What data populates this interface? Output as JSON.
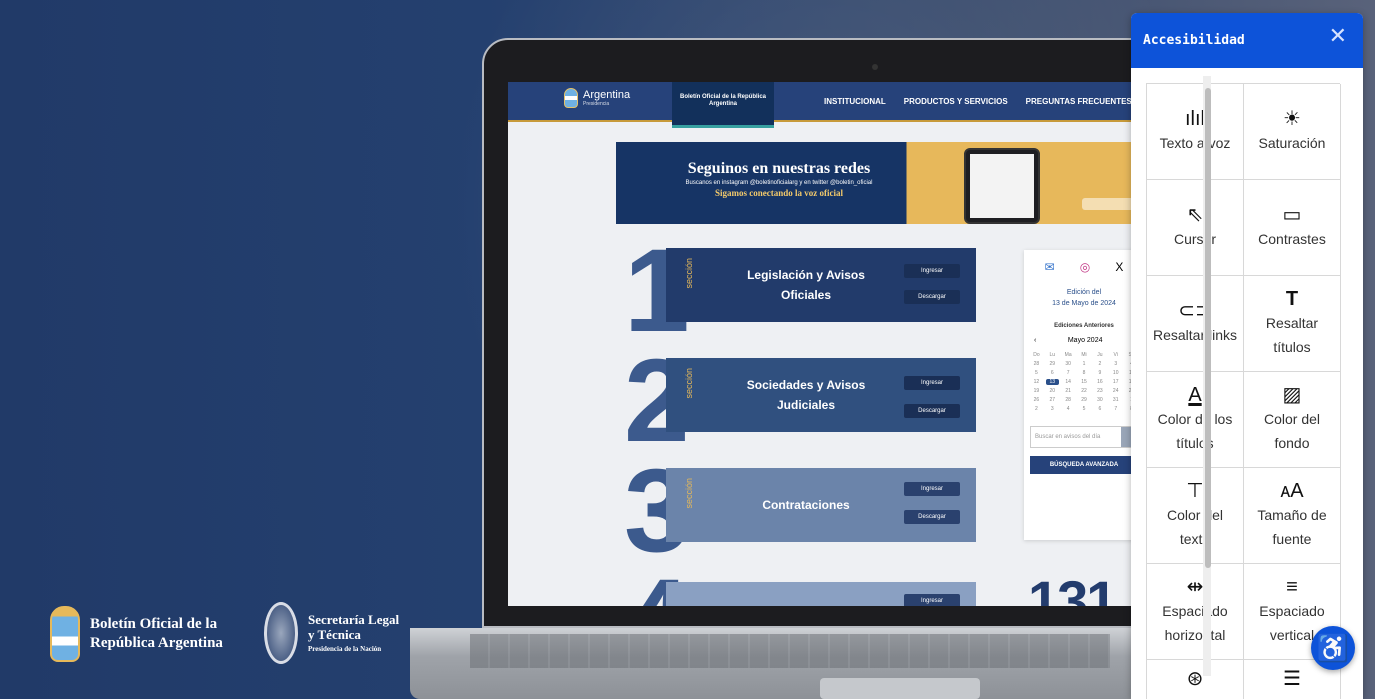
{
  "site": {
    "brand_logo": "Argentina",
    "brand_logo_sub": "Presidencia",
    "brand_title": "Boletín Oficial de la República Argentina",
    "nav": [
      "INSTITUCIONAL",
      "PRODUCTOS Y SERVICIOS",
      "PREGUNTAS FRECUENTES"
    ],
    "banner": {
      "title": "Seguinos en nuestras redes",
      "subtitle": "Buscanos en instagram @boletinoficialarg y en twitter @boletin_oficial",
      "tagline": "Sigamos conectando la voz oficial"
    },
    "sections": [
      {
        "number": "1",
        "label": "sección",
        "title": "Legislación y Avisos Oficiales",
        "btn1": "Ingresar",
        "btn2": "Descargar"
      },
      {
        "number": "2",
        "label": "sección",
        "title": "Sociedades y Avisos Judiciales",
        "btn1": "Ingresar",
        "btn2": "Descargar"
      },
      {
        "number": "3",
        "label": "sección",
        "title": "Contrataciones",
        "btn1": "Ingresar",
        "btn2": "Descargar"
      },
      {
        "number": "4",
        "label": "sección",
        "title": "",
        "btn1": "Ingresar",
        "btn2": ""
      }
    ],
    "sidebar": {
      "edition": "Edición del",
      "edition_date": "13 de Mayo de 2024",
      "previous": "Ediciones Anteriores",
      "month": "Mayo 2024",
      "search_placeholder": "Buscar en avisos del día",
      "advanced_search": "BÚSQUEDA AVANZADA",
      "big_number": "131"
    }
  },
  "accessibility": {
    "title": "Accesibilidad",
    "items": [
      {
        "label": "Texto a voz",
        "icon": "sound-wave-icon"
      },
      {
        "label": "Saturación",
        "icon": "brightness-icon"
      },
      {
        "label": "Cursor",
        "icon": "cursor-icon"
      },
      {
        "label": "Contrastes",
        "icon": "monitor-icon"
      },
      {
        "label": "Resaltar links",
        "icon": "link-icon"
      },
      {
        "label": "Resaltar títulos",
        "icon": "heading-icon"
      },
      {
        "label": "Color de los títulos",
        "icon": "text-color-icon"
      },
      {
        "label": "Color del fondo",
        "icon": "image-icon"
      },
      {
        "label": "Color del texto",
        "icon": "text-box-icon"
      },
      {
        "label": "Tamaño de fuente",
        "icon": "font-size-icon"
      },
      {
        "label": "Espaciado horizontal",
        "icon": "horizontal-spacing-icon"
      },
      {
        "label": "Espaciado vertical",
        "icon": "vertical-spacing-icon"
      }
    ]
  },
  "footer_logos": {
    "bo_line1": "Boletín Oficial de la",
    "bo_line2": "República Argentina",
    "slt_line1": "Secretaría Legal",
    "slt_line2": "y Técnica",
    "slt_sub": "Presidencia de la Nación"
  }
}
